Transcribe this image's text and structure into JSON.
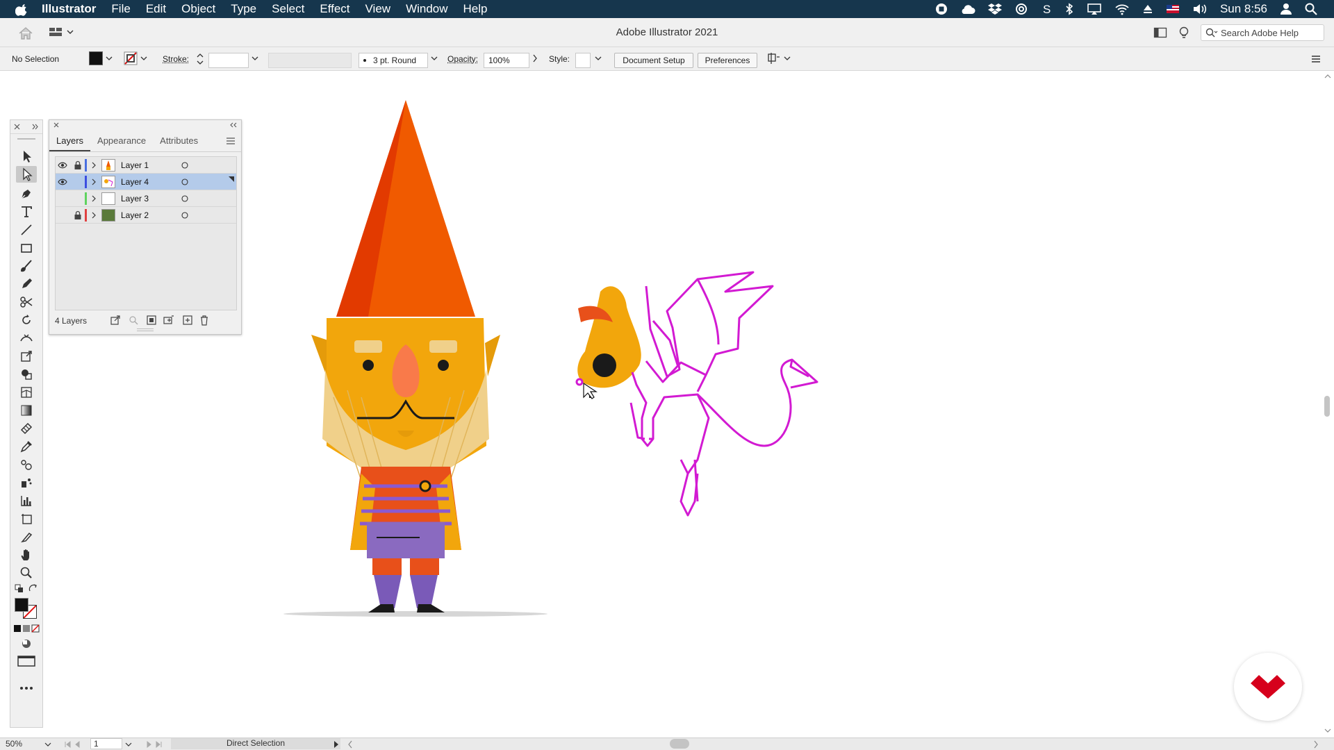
{
  "menubar": {
    "app_name": "Illustrator",
    "items": [
      "File",
      "Edit",
      "Object",
      "Type",
      "Select",
      "Effect",
      "View",
      "Window",
      "Help"
    ],
    "clock": "Sun 8:56"
  },
  "window": {
    "title": "Adobe Illustrator 2021",
    "search_placeholder": "Search Adobe Help"
  },
  "control_bar": {
    "selection_label": "No Selection",
    "stroke_label": "Stroke:",
    "brush_label": "3 pt. Round",
    "opacity_label": "Opacity:",
    "opacity_value": "100%",
    "style_label": "Style:",
    "document_setup": "Document Setup",
    "preferences": "Preferences"
  },
  "layers_panel": {
    "tabs": [
      "Layers",
      "Appearance",
      "Attributes"
    ],
    "active_tab": "Layers",
    "layers": [
      {
        "name": "Layer 1",
        "color": "#4a6fe0",
        "visible": true,
        "locked": true,
        "selected": false
      },
      {
        "name": "Layer 4",
        "color": "#3b4ee0",
        "visible": true,
        "locked": false,
        "selected": true
      },
      {
        "name": "Layer 3",
        "color": "#5fd35f",
        "visible": false,
        "locked": false,
        "selected": false
      },
      {
        "name": "Layer 2",
        "color": "#e04040",
        "visible": false,
        "locked": true,
        "selected": false
      }
    ],
    "footer_count": "4 Layers"
  },
  "status_bar": {
    "zoom": "50%",
    "artboard": "1",
    "tool": "Direct Selection"
  },
  "colors": {
    "menubar_bg": "#16364d",
    "selection_path": "#d21ad2",
    "hat": "#f05a00",
    "face": "#f2a60c",
    "beard": "#f0d08a"
  }
}
